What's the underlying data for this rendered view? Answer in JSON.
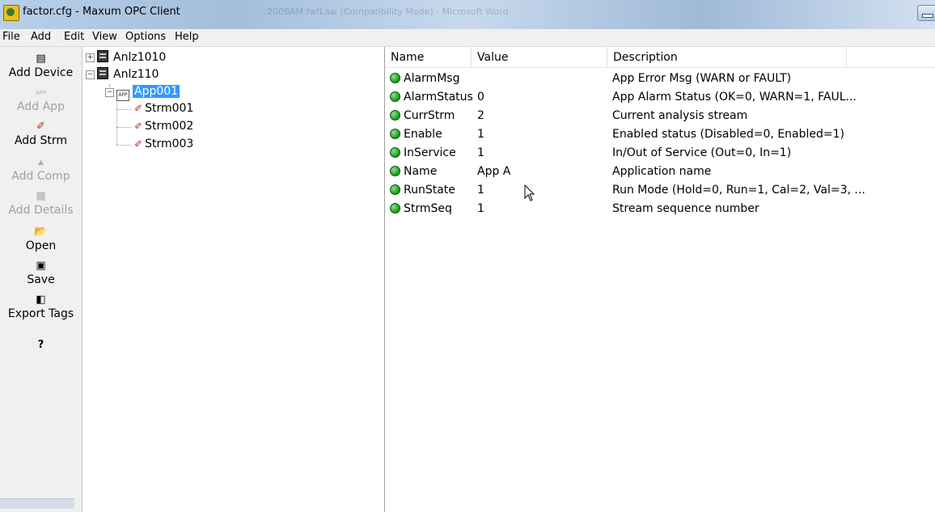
{
  "window": {
    "title": "factor.cfg - Maxum  OPC  Client",
    "background_title": "2008AM fwfLaw (Compatibility Mode) - Microsoft Word"
  },
  "menu": [
    "File",
    "Add",
    "Edit",
    "View",
    "Options",
    "Help"
  ],
  "toolbar": {
    "buttons": [
      {
        "label": "Add Device",
        "icon": "device-icon",
        "enabled": true
      },
      {
        "label": "Add App",
        "icon": "app-icon",
        "enabled": false
      },
      {
        "label": "Add Strm",
        "icon": "stream-icon",
        "enabled": true
      },
      {
        "label": "Add Comp",
        "icon": "component-icon",
        "enabled": false
      },
      {
        "label": "Add Details",
        "icon": "details-icon",
        "enabled": false
      },
      {
        "label": "Open",
        "icon": "folder-open-icon",
        "enabled": true
      },
      {
        "label": "Save",
        "icon": "floppy-disk-icon",
        "enabled": true
      },
      {
        "label": "Export Tags",
        "icon": "export-icon",
        "enabled": true
      },
      {
        "label": "",
        "icon": "help-icon",
        "enabled": true
      }
    ]
  },
  "tree": {
    "devices": [
      {
        "label": "Anlz1010",
        "expanded": false
      },
      {
        "label": "Anlz110",
        "expanded": true
      }
    ],
    "app": {
      "label": "App001",
      "selected": true
    },
    "streams": [
      "Strm001",
      "Strm002",
      "Strm003"
    ]
  },
  "list": {
    "columns": [
      "Name",
      "Value",
      "Description"
    ],
    "rows": [
      {
        "name": "AlarmMsg",
        "value": "",
        "description": "App Error Msg (WARN or FAULT)"
      },
      {
        "name": "AlarmStatus",
        "value": "0",
        "description": "App Alarm Status (OK=0, WARN=1, FAUL..."
      },
      {
        "name": "CurrStrm",
        "value": "2",
        "description": "Current analysis stream"
      },
      {
        "name": "Enable",
        "value": "1",
        "description": "Enabled status (Disabled=0, Enabled=1)"
      },
      {
        "name": "InService",
        "value": "1",
        "description": "In/Out of Service (Out=0, In=1)"
      },
      {
        "name": "Name",
        "value": "App A",
        "description": "Application name"
      },
      {
        "name": "RunState",
        "value": "1",
        "description": "Run Mode (Hold=0, Run=1, Cal=2, Val=3, ..."
      },
      {
        "name": "StrmSeq",
        "value": "1",
        "description": "Stream sequence number"
      }
    ],
    "status_color": "#2aa52a"
  }
}
